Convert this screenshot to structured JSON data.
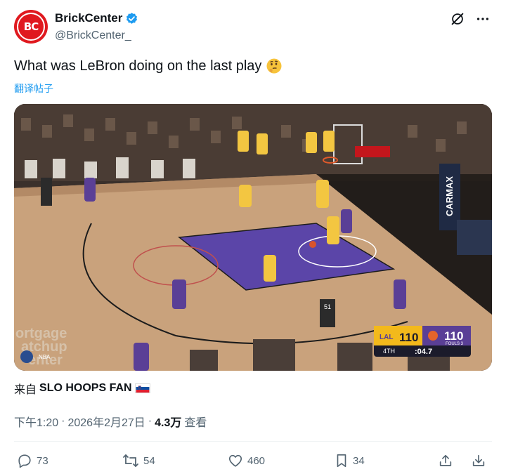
{
  "account": {
    "display_name": "BrickCenter",
    "handle": "@BrickCenter_",
    "avatar_text": "BC",
    "verified": true
  },
  "tweet": {
    "text": "What was LeBron doing on the last play",
    "emoji": "thinking-face",
    "translate_label": "翻译帖子"
  },
  "media": {
    "scoreboard": {
      "team1_score": "110",
      "team2_score": "110",
      "quarter": "4TH",
      "clock": ":04.7",
      "team2_info": "FOULS 3"
    },
    "jersey_number": "51",
    "courtside_ad_text": "ortgage\natchup\nenter",
    "banner_text": "CARMAX",
    "network_logo": "NBA"
  },
  "source": {
    "prefix": "来自",
    "name": "SLO HOOPS FAN"
  },
  "meta": {
    "time": "下午1:20",
    "separator": "·",
    "date": "2026年2月27日",
    "views_count": "4.3万",
    "views_label": "查看"
  },
  "actions": {
    "replies": "73",
    "reposts": "54",
    "likes": "460",
    "bookmarks": "34"
  },
  "colors": {
    "accent": "#1d9bf0",
    "secondary_text": "#536471",
    "avatar_red": "#e0191f"
  }
}
